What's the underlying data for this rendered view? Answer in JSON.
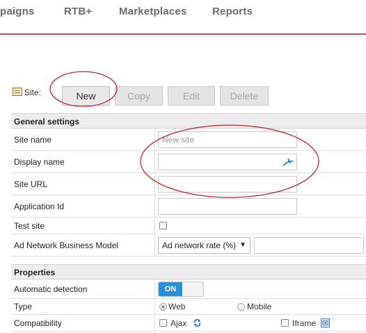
{
  "nav": {
    "items": [
      "paigns",
      "RTB+",
      "Marketplaces",
      "Reports"
    ]
  },
  "toolbar": {
    "site_label": "Site:",
    "buttons": {
      "new": "New",
      "copy": "Copy",
      "edit": "Edit",
      "delete": "Delete"
    }
  },
  "general": {
    "title": "General settings",
    "site_name": {
      "label": "Site name",
      "placeholder": "New site"
    },
    "display_name": {
      "label": "Display name"
    },
    "site_url": {
      "label": "Site URL"
    },
    "application_id": {
      "label": "Application Id"
    },
    "test_site": {
      "label": "Test site"
    },
    "business_model": {
      "label": "Ad Network Business Model",
      "selected": "Ad network rate (%)"
    }
  },
  "properties": {
    "title": "Properties",
    "automatic_detection": {
      "label": "Automatic detection",
      "toggle": "ON"
    },
    "type": {
      "label": "Type",
      "options": [
        "Web",
        "Mobile"
      ],
      "selected": "Web"
    },
    "compatibility": {
      "label": "Compatibility",
      "options": [
        "Ajax",
        "Iframe"
      ]
    }
  },
  "colors": {
    "nav_border": "#a45a63",
    "toggle_on": "#2b8fd8",
    "annotation": "#c0242c"
  }
}
